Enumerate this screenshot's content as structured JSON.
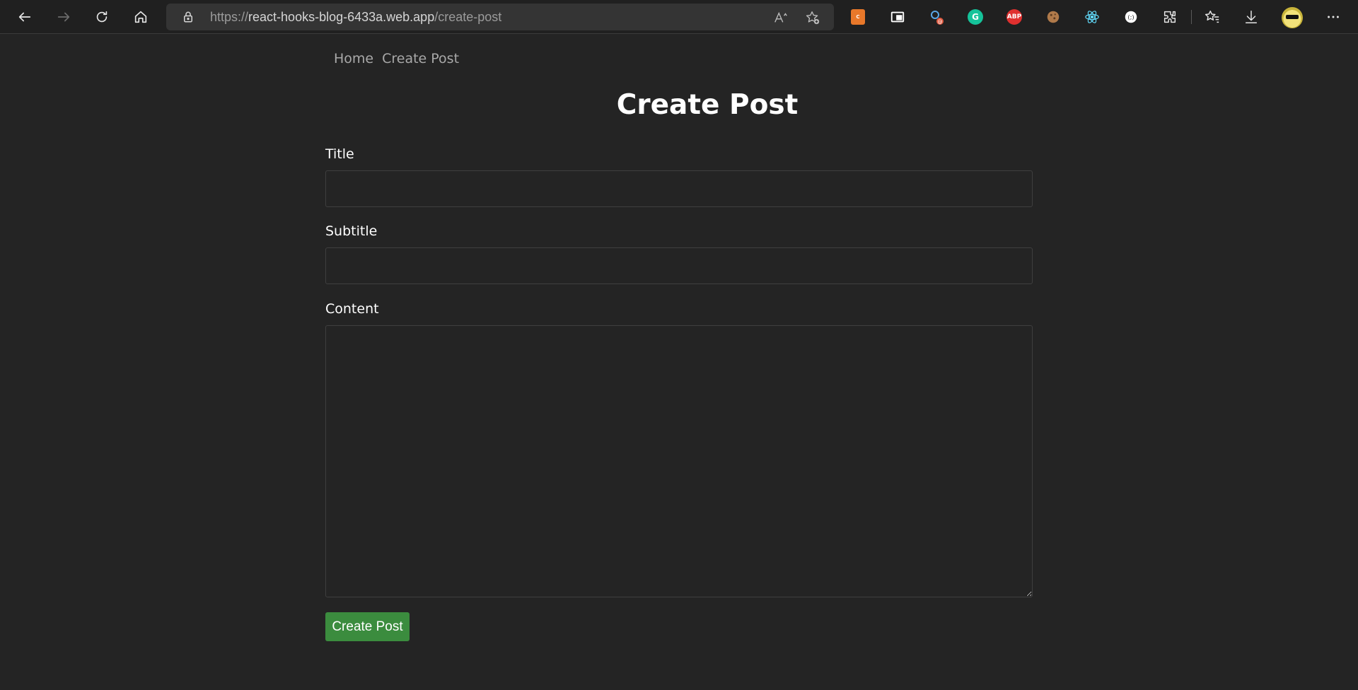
{
  "browser": {
    "url_base": "https://",
    "url_host": "react-hooks-blog-6433a.web.app",
    "url_path": "/create-post",
    "icons": [
      "back-arrow-icon",
      "forward-arrow-icon",
      "refresh-icon",
      "home-icon",
      "lock-icon",
      "read-aloud-icon",
      "add-favorite-icon",
      "favorites-icon",
      "downloads-icon",
      "extensions-icon",
      "more-icon"
    ],
    "extensions": [
      {
        "name": "skip-extension-icon",
        "label": "SKIP",
        "color": "#e8782a"
      },
      {
        "name": "picture-in-picture-extension-icon",
        "label": "",
        "color": "#ffffff"
      },
      {
        "name": "link-extension-icon",
        "label": "",
        "color": "#3a8fd9"
      },
      {
        "name": "grammarly-extension-icon",
        "label": "G",
        "color": "#15c39a"
      },
      {
        "name": "adblock-plus-extension-icon",
        "label": "ABP",
        "color": "#e0302f"
      },
      {
        "name": "cookie-extension-icon",
        "label": "",
        "color": "#b07a4a"
      },
      {
        "name": "react-devtools-extension-icon",
        "label": "",
        "color": "#61dafb"
      },
      {
        "name": "circle-extension-icon",
        "label": "",
        "color": "#ffffff"
      }
    ]
  },
  "nav": {
    "home": "Home",
    "create_post": "Create Post"
  },
  "page": {
    "title": "Create Post"
  },
  "form": {
    "title_label": "Title",
    "title_value": "",
    "subtitle_label": "Subtitle",
    "subtitle_value": "",
    "content_label": "Content",
    "content_value": "",
    "submit_label": "Create Post",
    "submit_color": "#3b8c3e"
  }
}
